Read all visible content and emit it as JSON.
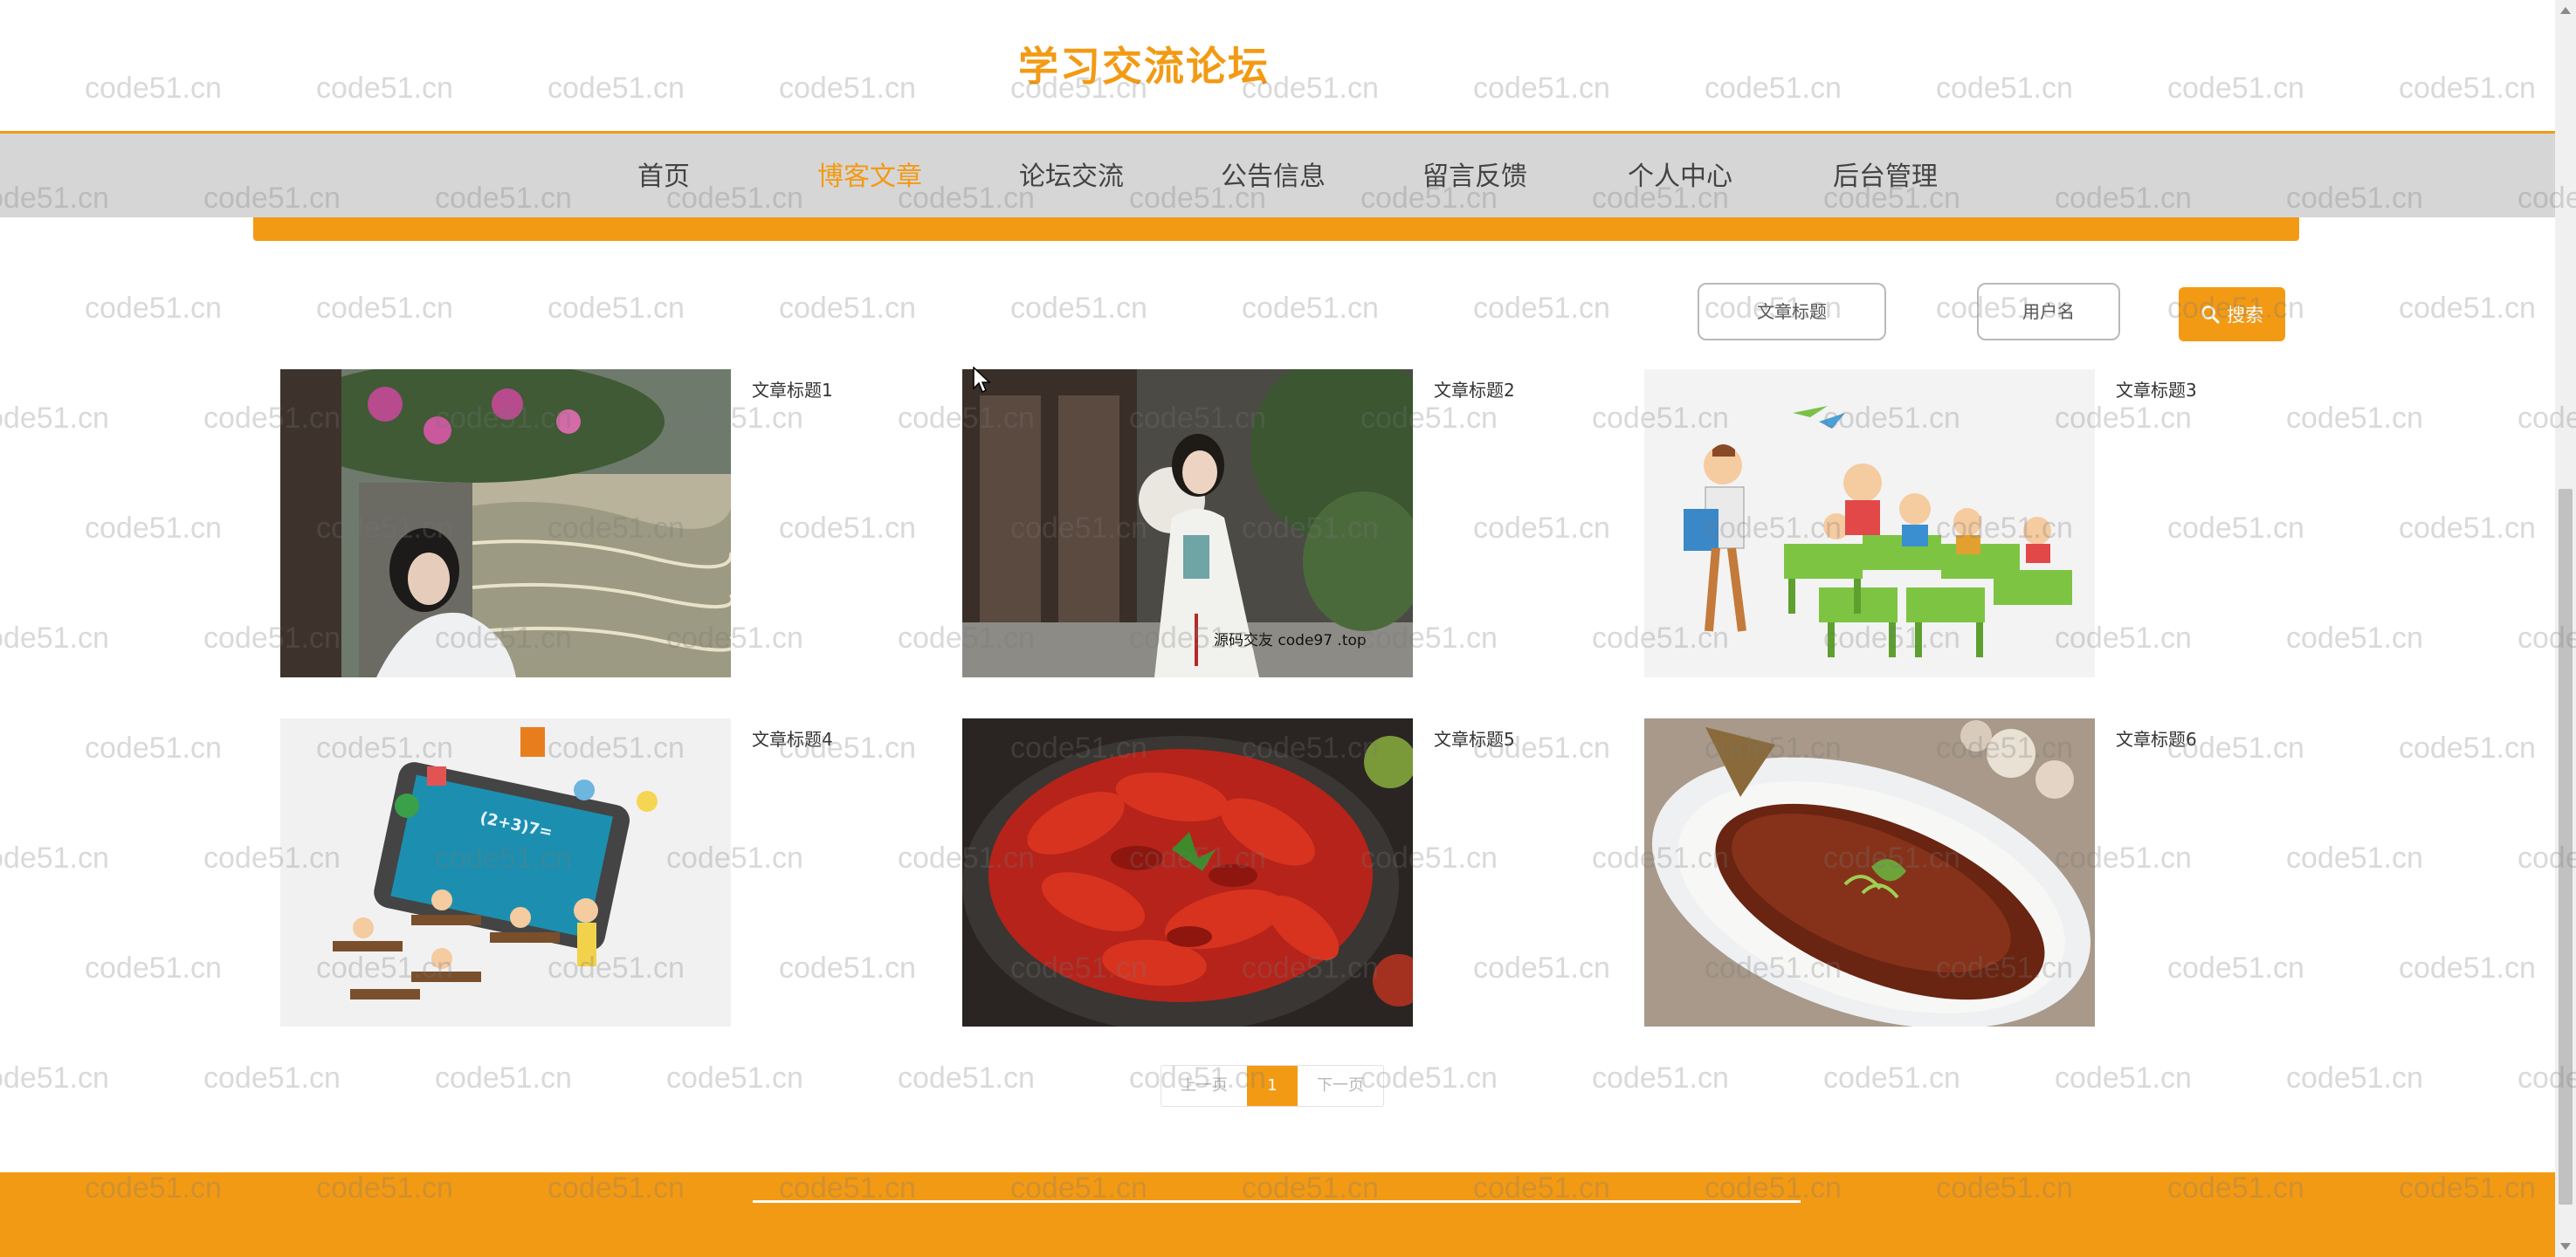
{
  "header": {
    "site_title": "学习交流论坛"
  },
  "nav": {
    "items": [
      {
        "label": "首页",
        "active": false
      },
      {
        "label": "博客文章",
        "active": true
      },
      {
        "label": "论坛交流",
        "active": false
      },
      {
        "label": "公告信息",
        "active": false
      },
      {
        "label": "留言反馈",
        "active": false
      },
      {
        "label": "个人中心",
        "active": false
      },
      {
        "label": "后台管理",
        "active": false
      }
    ]
  },
  "search": {
    "title_placeholder": "文章标题",
    "user_placeholder": "用户名",
    "button_label": "搜索"
  },
  "articles": [
    {
      "title": "文章标题1",
      "image": "woman-in-hanfu-by-canal-photo"
    },
    {
      "title": "文章标题2",
      "image": "woman-in-hanfu-with-fan-photo",
      "image_caption": "源码交友 code97 .top"
    },
    {
      "title": "文章标题3",
      "image": "teacher-and-classroom-illustration"
    },
    {
      "title": "文章标题4",
      "image": "online-class-tablet-illustration",
      "image_caption": "(2+3)7="
    },
    {
      "title": "文章标题5",
      "image": "crayfish-plate-photo"
    },
    {
      "title": "文章标题6",
      "image": "braised-fish-photo"
    }
  ],
  "pagination": {
    "prev_label": "上一页",
    "current_page": "1",
    "next_label": "下一页"
  },
  "watermark": {
    "text": "code51.cn"
  },
  "colors": {
    "accent": "#f39a14",
    "nav_bg": "#d6d6d6"
  }
}
